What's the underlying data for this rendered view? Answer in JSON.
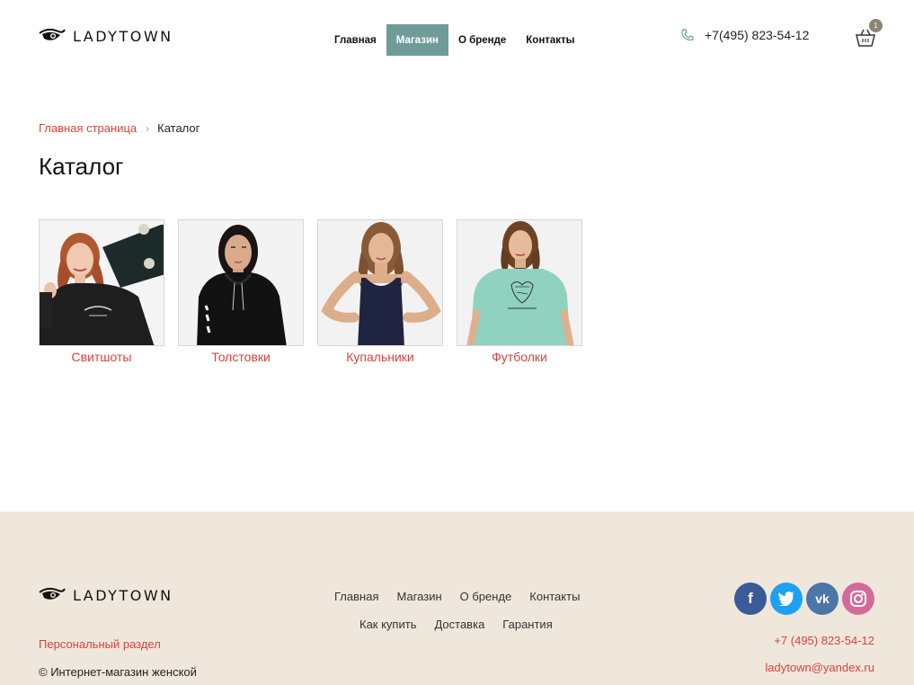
{
  "brand": {
    "name": "LADYTOWN"
  },
  "nav": {
    "items": [
      {
        "label": "Главная",
        "active": false
      },
      {
        "label": "Магазин",
        "active": true
      },
      {
        "label": "О бренде",
        "active": false
      },
      {
        "label": "Контакты",
        "active": false
      }
    ]
  },
  "header": {
    "phone": "+7(495) 823-54-12",
    "cart_count": "1"
  },
  "breadcrumb": {
    "home": "Главная страница",
    "current": "Каталог"
  },
  "page": {
    "title": "Каталог"
  },
  "catalog": {
    "items": [
      {
        "label": "Свитшоты",
        "icon": "sweatshirt-photo"
      },
      {
        "label": "Толстовки",
        "icon": "hoodie-photo"
      },
      {
        "label": "Купальники",
        "icon": "swimsuit-photo"
      },
      {
        "label": "Футболки",
        "icon": "tshirt-photo"
      }
    ]
  },
  "footer": {
    "nav1": [
      "Главная",
      "Магазин",
      "О бренде",
      "Контакты"
    ],
    "nav2": [
      "Как купить",
      "Доставка",
      "Гарантия"
    ],
    "personal": "Персональный раздел",
    "copyright": "© Интернет-магазин женской",
    "phone": "+7 (495) 823-54-12",
    "email": "ladytown@yandex.ru",
    "socials": [
      {
        "name": "facebook",
        "glyph": "f"
      },
      {
        "name": "twitter",
        "glyph": "t"
      },
      {
        "name": "vk",
        "glyph": "vk"
      },
      {
        "name": "instagram",
        "glyph": "ig"
      }
    ]
  },
  "colors": {
    "accent": "#d9423b",
    "nav_active": "#6f9b98",
    "footer_bg": "#f0e7dc",
    "badge": "#8d8574"
  }
}
